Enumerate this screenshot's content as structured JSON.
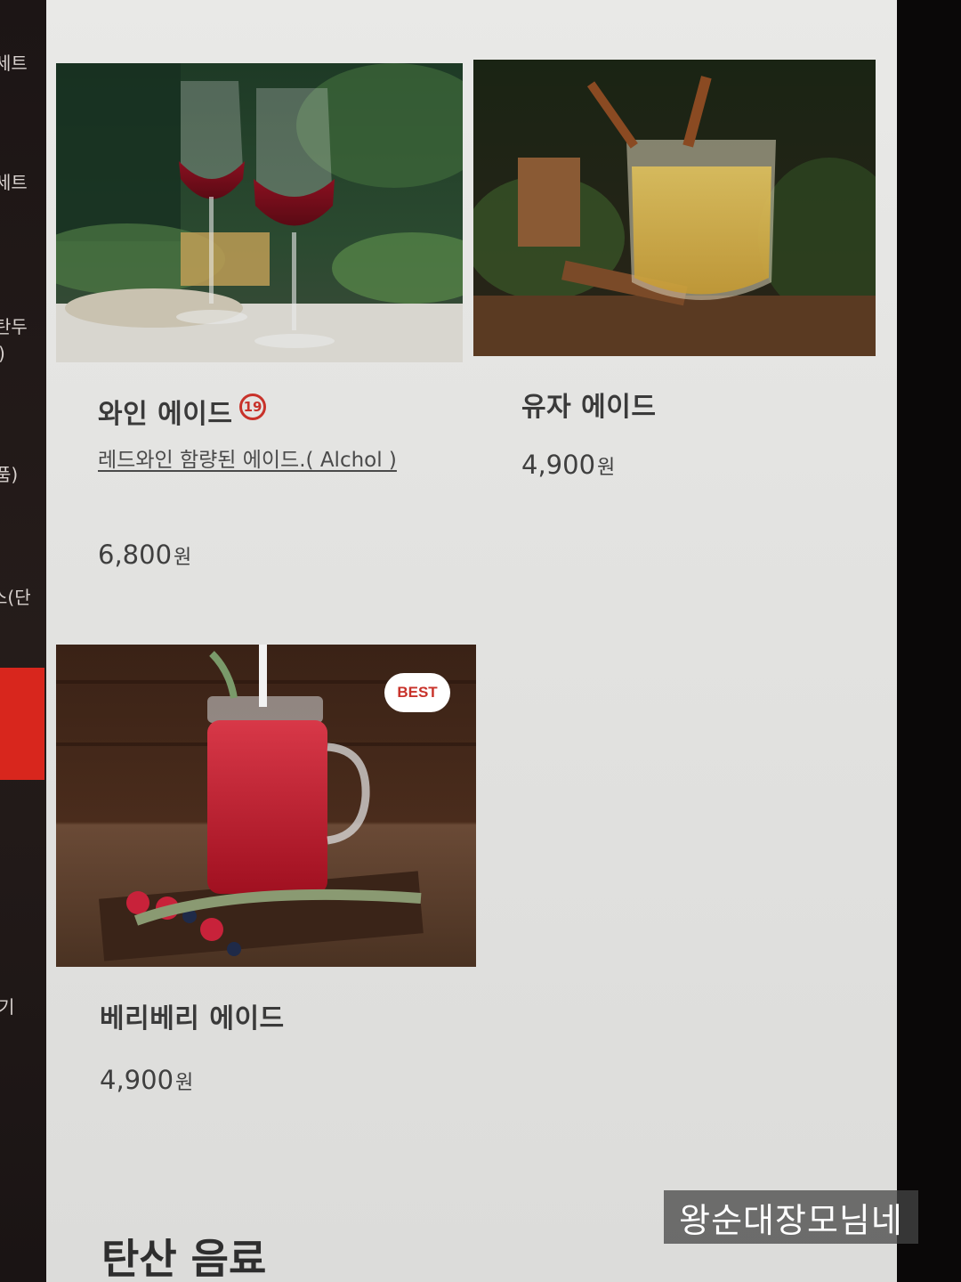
{
  "sidebar": {
    "items": [
      {
        "label": "세트"
      },
      {
        "label": "세트"
      },
      {
        "label": "탄두"
      },
      {
        "label": ")"
      },
      {
        "label": "품)"
      },
      {
        "label": "스(단"
      },
      {
        "label": "기"
      }
    ]
  },
  "menu": {
    "items": [
      {
        "name": "와인 에이드",
        "age_badge": "19",
        "description": "레드와인 함량된 에이드.( Alchol )",
        "price": "6,800",
        "currency": "원"
      },
      {
        "name": "유자 에이드",
        "price": "4,900",
        "currency": "원"
      },
      {
        "name": "베리베리 에이드",
        "badge": "BEST",
        "price": "4,900",
        "currency": "원"
      }
    ]
  },
  "section": {
    "title": "탄산 음료"
  },
  "watermark": "왕순대장모님네",
  "colors": {
    "accent": "#d8261d",
    "badge_red": "#c8322a",
    "panel_bg": "#e6e6e4"
  }
}
